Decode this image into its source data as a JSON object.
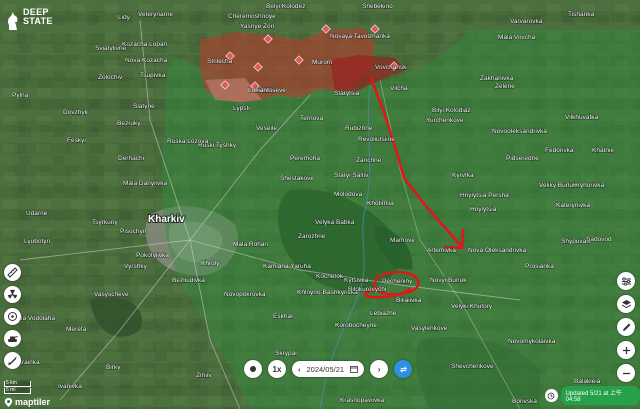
{
  "brand": {
    "name": "DEEP STATE",
    "line1": "DEEP",
    "line2": "STATE"
  },
  "map": {
    "city": "Kharkiv",
    "places": [
      {
        "name": "Lidy"
      },
      {
        "name": "Veterynarne"
      },
      {
        "name": "Cheremoshnoye"
      },
      {
        "name": "Belyi Kolodez"
      },
      {
        "name": "Shebekino"
      },
      {
        "name": "Varvarovka"
      },
      {
        "name": "Tishanka"
      },
      {
        "name": "Yasnye Zori"
      },
      {
        "name": "Novaya Tavolzhanka"
      },
      {
        "name": "Kozacha Lopan"
      },
      {
        "name": "Sviatylivne"
      },
      {
        "name": "Mala Vovcha"
      },
      {
        "name": "Mala Danylivka"
      },
      {
        "name": "Nova Kozacha"
      },
      {
        "name": "Tsupivka"
      },
      {
        "name": "Strilecha"
      },
      {
        "name": "Murom"
      },
      {
        "name": "Ohirtseve"
      },
      {
        "name": "Vovchansk"
      },
      {
        "name": "Zolochiv"
      },
      {
        "name": "Pylna"
      },
      {
        "name": "Starytsia"
      },
      {
        "name": "Vilcha"
      },
      {
        "name": "Lukiantsi"
      },
      {
        "name": "Zelene"
      },
      {
        "name": "Rubizhne"
      },
      {
        "name": "Ruska Lozova"
      },
      {
        "name": "Ternova"
      },
      {
        "name": "Slatyne"
      },
      {
        "name": "Dovzhyk"
      },
      {
        "name": "Bezruky"
      },
      {
        "name": "Feskyi"
      },
      {
        "name": "Zakhanivka"
      },
      {
        "name": "Bilyi Kolodiaz"
      },
      {
        "name": "Yurchenkove"
      },
      {
        "name": "Novooleksandrivka"
      },
      {
        "name": "Vilkhuvatka"
      },
      {
        "name": "Fedorivka"
      },
      {
        "name": "Pidseredne"
      },
      {
        "name": "Khatnie"
      },
      {
        "name": "Veseile"
      },
      {
        "name": "Ruski Tyshky"
      },
      {
        "name": "Lypsti"
      },
      {
        "name": "Peremoha"
      },
      {
        "name": "Revoliutsiine"
      },
      {
        "name": "Zarichne"
      },
      {
        "name": "Shestakove"
      },
      {
        "name": "Derhachi"
      },
      {
        "name": "Kyrvtka"
      },
      {
        "name": "Veliky Burluk"
      },
      {
        "name": "Hryhorivka"
      },
      {
        "name": "Hnylytsia Persha"
      },
      {
        "name": "Staryi Saltiv"
      },
      {
        "name": "Molodova"
      },
      {
        "name": "Khotimlia"
      },
      {
        "name": "Katerynivka"
      },
      {
        "name": "Hnylytsia"
      },
      {
        "name": "Udarne"
      },
      {
        "name": "Tsyrkuny"
      },
      {
        "name": "Velyka Babka"
      },
      {
        "name": "Zarozhne"
      },
      {
        "name": "Mamove"
      },
      {
        "name": "Artemivka"
      },
      {
        "name": "Nova Oleksandrivka"
      },
      {
        "name": "Shypuvate"
      },
      {
        "name": "Sadovod"
      },
      {
        "name": "Pisochyn"
      },
      {
        "name": "Lyubotyn"
      },
      {
        "name": "Vyrshky"
      },
      {
        "name": "Pokotylivka"
      },
      {
        "name": "Khroly"
      },
      {
        "name": "Mala Rohan"
      },
      {
        "name": "Kamiana Yaruha"
      },
      {
        "name": "Kochetok"
      },
      {
        "name": "Kytsivka"
      },
      {
        "name": "Pechenihy"
      },
      {
        "name": "Novyi Burluk"
      },
      {
        "name": "Prosianka"
      },
      {
        "name": "Bezliudivka"
      },
      {
        "name": "Vasyscheve"
      },
      {
        "name": "Novopokrovka"
      },
      {
        "name": "Khlnyno-Bashkyrivka"
      },
      {
        "name": "Bilokurovychi"
      },
      {
        "name": "Velyki Khutory"
      },
      {
        "name": "Biliaiivka"
      },
      {
        "name": "Eskhar"
      },
      {
        "name": "Korobocheyne"
      },
      {
        "name": "Lebiazhe"
      },
      {
        "name": "Vasylenkove"
      },
      {
        "name": "Mala Vodolaha"
      },
      {
        "name": "Merefa"
      },
      {
        "name": "Skrypai"
      },
      {
        "name": "Zmiiv"
      },
      {
        "name": "Birky"
      },
      {
        "name": "Shevchenkove"
      },
      {
        "name": "Novomykolaivka"
      },
      {
        "name": "Balakleia"
      },
      {
        "name": "Borivska"
      },
      {
        "name": "Ukrainka"
      },
      {
        "name": "Ivanivka"
      },
      {
        "name": "Krasnopavlivka"
      },
      {
        "name": "Izium"
      }
    ]
  },
  "controls": {
    "left_tools": [
      "ruler-icon",
      "radiation-icon",
      "nuclear-icon",
      "tank-icon",
      "rocket-icon"
    ],
    "right_tools": [
      "filter-icon",
      "layers-icon",
      "pencil-icon",
      "plus-icon",
      "minus-icon"
    ],
    "play_icon": "play-icon",
    "speed": "1x",
    "date": "2024/05/21",
    "prev_icon": "chevron-left-icon",
    "next_icon": "chevron-right-icon",
    "calendar_icon": "calendar-icon",
    "sync_icon": "sync-icon"
  },
  "scale": {
    "km": "5 km",
    "mi": "5 mi"
  },
  "attribution": {
    "name": "maptiler"
  },
  "status": {
    "updated": "Updated 5/21 at 上午04:58"
  },
  "colors": {
    "liberated": "#2f8f3e",
    "occupied": "#c0392b",
    "annotation": "#e0161b",
    "accent": "#2f8fe0",
    "status": "#27a04a"
  }
}
